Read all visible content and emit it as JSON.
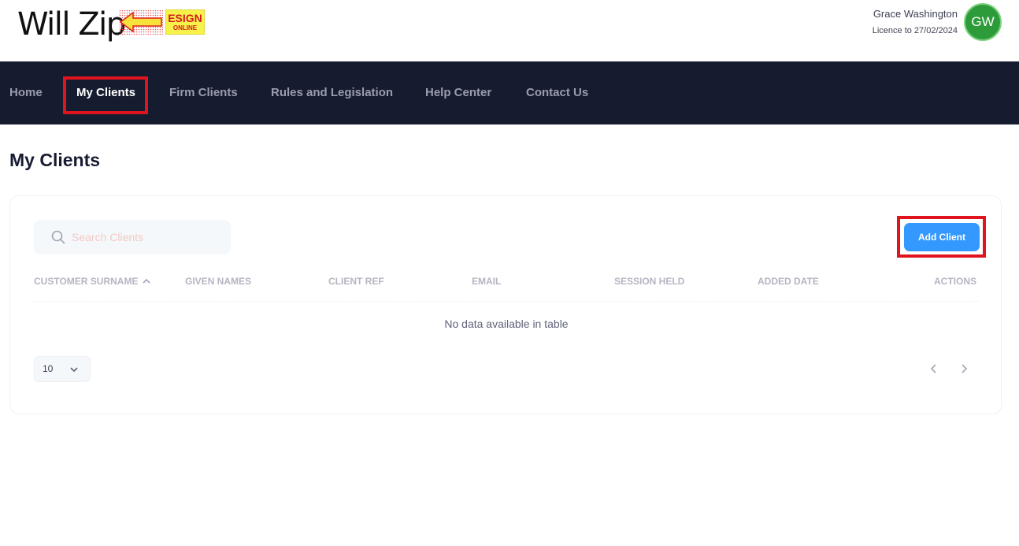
{
  "brand": {
    "logo_text": "Will Zip",
    "badge_line1": "ESIGN",
    "badge_line2": "ONLINE"
  },
  "user": {
    "name": "Grace Washington",
    "licence": "Licence to 27/02/2024",
    "initials": "GW"
  },
  "nav": {
    "items": [
      {
        "label": "Home"
      },
      {
        "label": "My Clients"
      },
      {
        "label": "Firm Clients"
      },
      {
        "label": "Rules and Legislation"
      },
      {
        "label": "Help Center"
      },
      {
        "label": "Contact Us"
      }
    ],
    "active_index": 1
  },
  "page": {
    "title": "My Clients"
  },
  "search": {
    "placeholder": "Search Clients",
    "value": ""
  },
  "toolbar": {
    "add_label": "Add Client"
  },
  "table": {
    "columns": [
      "CUSTOMER SURNAME",
      "GIVEN NAMES",
      "CLIENT REF",
      "EMAIL",
      "SESSION HELD",
      "ADDED DATE",
      "ACTIONS"
    ],
    "sorted_column": "CUSTOMER SURNAME",
    "sort_direction": "ascending",
    "empty_message": "No data available in table",
    "rows": []
  },
  "pagination": {
    "page_size": "10"
  },
  "colors": {
    "nav_bg": "#161c2f",
    "accent": "#3399ff",
    "highlight": "#e0141e",
    "avatar_bg": "#2e9b3b"
  }
}
